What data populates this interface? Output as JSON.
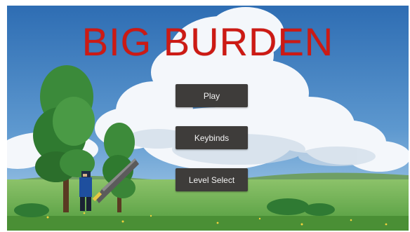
{
  "game": {
    "title": "BIG BURDEN",
    "menu": {
      "play_label": "Play",
      "keybinds_label": "Keybinds",
      "level_select_label": "Level Select"
    }
  },
  "colors": {
    "title": "#cc1a14",
    "button_bg": "#3e3c3a",
    "button_text": "#f2f2f2",
    "sky_top": "#2f6fb5",
    "sky_bottom": "#a9cdea",
    "grass": "#6fae4c"
  },
  "icons": {
    "player_character": "pixel-knight-with-large-sword",
    "trees": "pixel-trees",
    "clouds": "cumulus-clouds"
  }
}
